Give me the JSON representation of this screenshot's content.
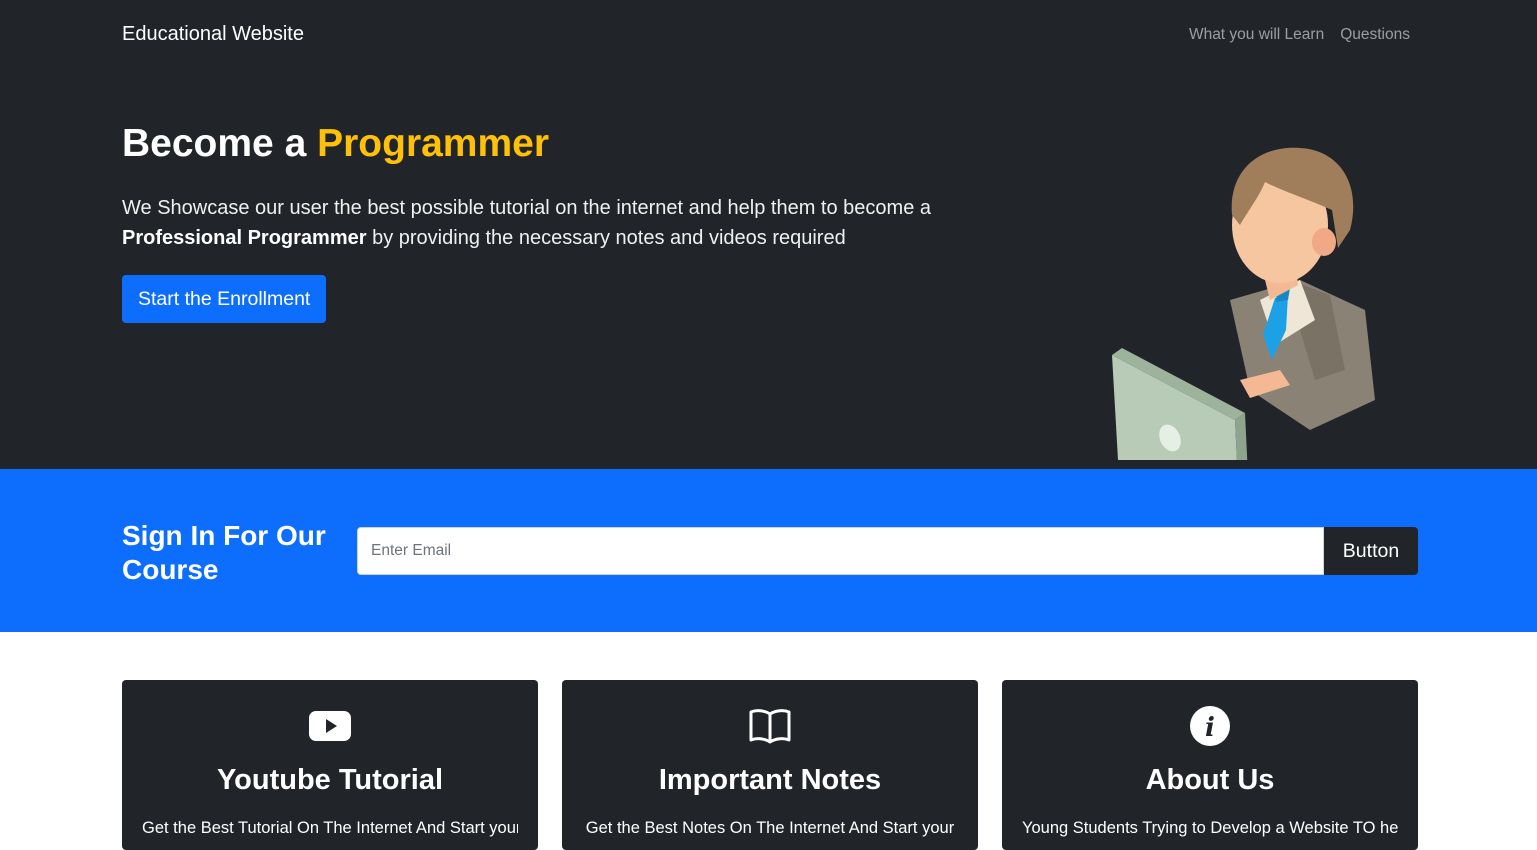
{
  "navbar": {
    "brand": "Educational Website",
    "links": [
      "What you will Learn",
      "Questions"
    ]
  },
  "hero": {
    "title_prefix": "Become a",
    "title_accent": "Programmer",
    "text_part1": "We Showcase our user the best possible tutorial on the internet and help them to become a",
    "text_bold": "Professional Programmer",
    "text_part2": "by providing the necessary notes and videos required",
    "button_label": "Start the Enrollment"
  },
  "signup": {
    "title": "Sign In For Our Course",
    "email_placeholder": "Enter Email",
    "button_label": "Button"
  },
  "cards": [
    {
      "icon": "youtube-icon",
      "title": "Youtube Tutorial",
      "text": "Get the Best Tutorial On The Internet And Start your"
    },
    {
      "icon": "book-icon",
      "title": "Important Notes",
      "text": "Get the Best Notes On The Internet And Start your"
    },
    {
      "icon": "info-icon",
      "title": "About Us",
      "text": "Young Students Trying to Develop a Website TO help"
    }
  ],
  "colors": {
    "dark": "#212529",
    "primary": "#0d6efd",
    "accent": "#ffc107"
  }
}
